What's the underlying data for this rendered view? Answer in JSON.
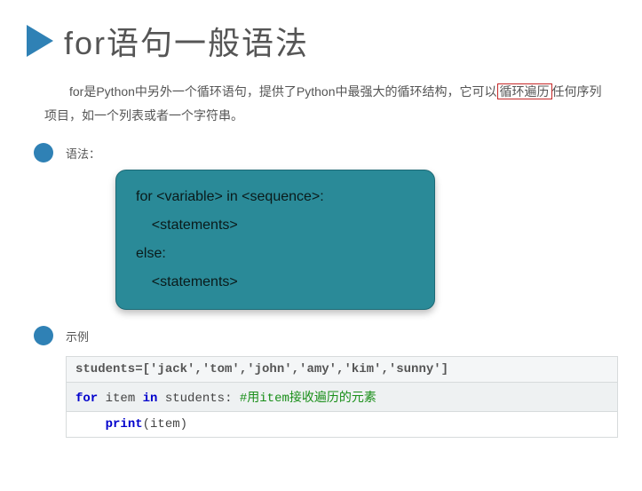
{
  "heading": "for语句一般语法",
  "intro_part1": "for是Python中另外一个循环语句，提供了Python中最强大的循环结构，它可以",
  "intro_highlight": "循环遍历",
  "intro_part2": "任何序列项目，如一个列表或者一个字符串。",
  "sections": {
    "syntax_label": "语法：",
    "example_label": "示例"
  },
  "syntax_code": "for <variable> in <sequence>:\n    <statements>\nelse:\n    <statements>",
  "code": {
    "line1_plain": "students=['jack','tom','john','amy','kim','sunny']",
    "line2": {
      "kw1": "for",
      "var": " item ",
      "kw2": "in",
      "rest": " students: ",
      "comment": "#用item接收遍历的元素"
    },
    "line3": {
      "indent": "    ",
      "fn": "print",
      "args": "(item)"
    }
  }
}
